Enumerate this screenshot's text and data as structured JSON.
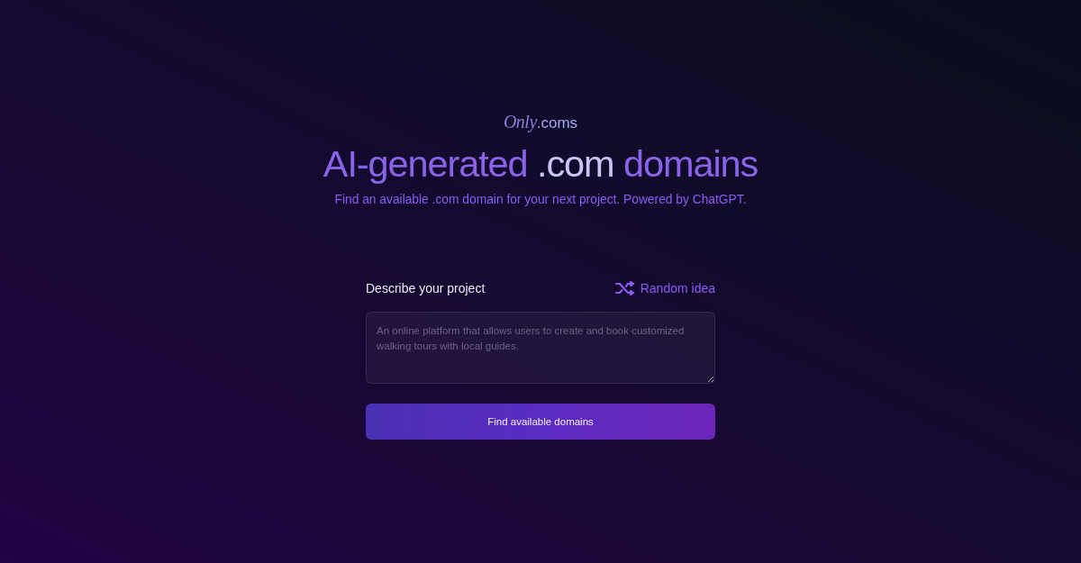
{
  "logo": {
    "script": "Only",
    "suffix": ".coms"
  },
  "heading": {
    "segments": [
      {
        "text": "AI-generated",
        "highlighted": false
      },
      {
        "text": ".com",
        "highlighted": true
      },
      {
        "text": "domains",
        "highlighted": false
      }
    ]
  },
  "subtitle": "Find an available .com domain for your next project. Powered by ChatGPT.",
  "form": {
    "label": "Describe your project",
    "random_button": "Random idea",
    "description": {
      "placeholder": "An online platform that allows users to create and book customized walking tours with local guides."
    },
    "submit_button": "Find available domains"
  }
}
